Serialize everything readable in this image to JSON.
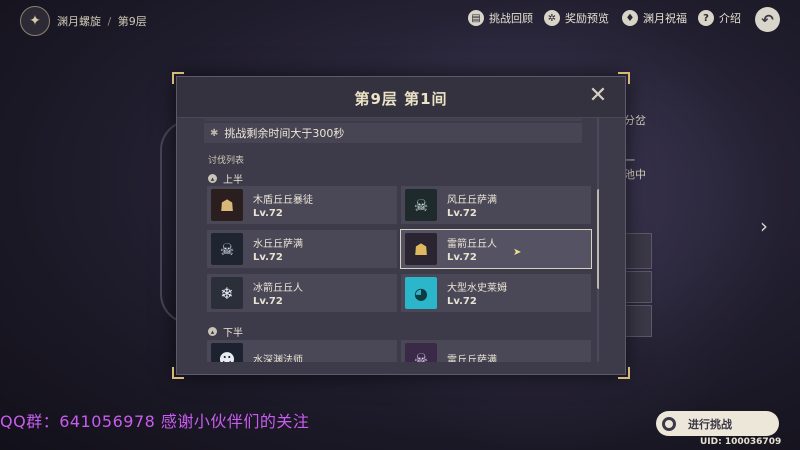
{
  "header": {
    "breadcrumb_parent": "渊月螺旋",
    "breadcrumb_separator": "/",
    "breadcrumb_current": "第9层",
    "nav": [
      {
        "label": "挑战回顾",
        "icon": "book-icon"
      },
      {
        "label": "奖励预览",
        "icon": "star-badge-icon"
      },
      {
        "label": "渊月祝福",
        "icon": "blessing-icon"
      },
      {
        "label": "介绍",
        "icon": "help-icon"
      }
    ]
  },
  "background": {
    "side_text_1": "分岔",
    "side_text_2": "一",
    "side_text_3": "池中"
  },
  "modal": {
    "title": "第9层 第1间",
    "close_label": "✕",
    "conditions": [
      {
        "text": "挑战剩余时间大于300秒"
      }
    ],
    "list_title": "讨伐列表",
    "first_half_label": "上半",
    "second_half_label": "下半",
    "first_half": [
      {
        "name": "木盾丘丘暴徒",
        "level": "Lv.72"
      },
      {
        "name": "风丘丘萨满",
        "level": "Lv.72"
      },
      {
        "name": "水丘丘萨满",
        "level": "Lv.72"
      },
      {
        "name": "雷箭丘丘人",
        "level": "Lv.72"
      },
      {
        "name": "冰箭丘丘人",
        "level": "Lv.72"
      },
      {
        "name": "大型水史莱姆",
        "level": "Lv.72"
      }
    ],
    "second_half": [
      {
        "name": "水深渊法师",
        "level": ""
      },
      {
        "name": "雷丘丘萨满",
        "level": ""
      }
    ]
  },
  "overlay": {
    "qq_text": "QQ群：641056978 感谢小伙伴们的关注"
  },
  "footer": {
    "start_label": "进行挑战",
    "uid": "UID: 100036709"
  }
}
